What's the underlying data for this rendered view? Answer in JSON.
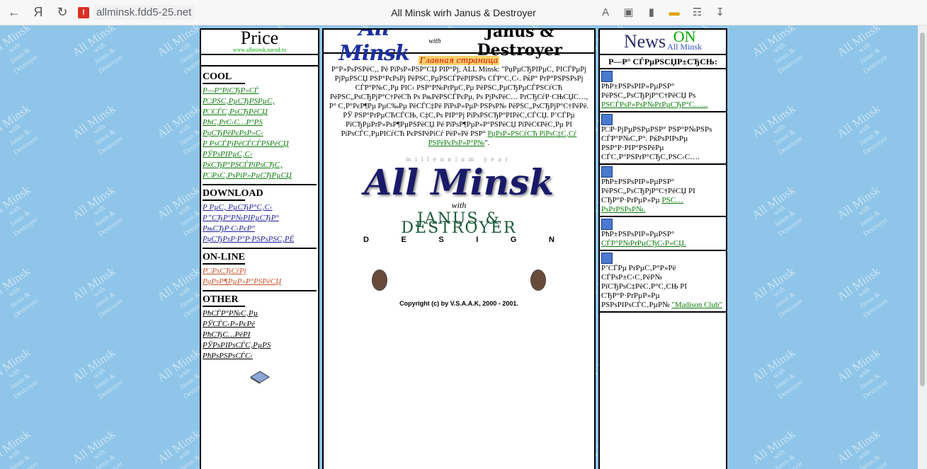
{
  "browser": {
    "url": "allminsk.fdd5-25.net",
    "title": "All Minsk wirh Janus & Destroyer",
    "back_glyph": "←",
    "home_glyph": "Я",
    "reload_glyph": "↻",
    "warning_glyph": "!"
  },
  "watermark": {
    "line1": "All Minsk",
    "line2": "with",
    "line3": "Janus &",
    "line4": "Destroyer"
  },
  "left": {
    "header": "Price",
    "header_sub": "www.allminsk.narod.ru",
    "sections": [
      {
        "title": "COOL",
        "style": "g",
        "items": [
          "Р—Р°РіСЂР»СЃ",
          "Р□РЅС‚РµСЂРЅРµС‚",
          "Р□СЃС‚РѕСЂРёСЏ",
          "РћС‚РґС‹С…Р°РЅ",
          "РџСЂРёРєРѕР»С‹",
          "Р РѕСЃРјРёСЃСЃРЅРёСЏ",
          "РЎРѕРІРµС‚С‹",
          "РќСЂР°РЅСЃРїРѕСЂС‚",
          "Р□РѕС‚РѕРіР»РµСЂРµСЏ"
        ]
      },
      {
        "title": "DOWNLOAD",
        "style": "b",
        "items": [
          "Р РµС‚ РµСЂР°С‚С‹",
          "Р”СЂР°Р№РІРµСЂР°",
          "РњСЂР·С‹РєР°",
          "РџСЂРѕР·Р°Р·РЅРѕРЅС‚РЁ"
        ]
      },
      {
        "title": "ON-LINE",
        "style": "o",
        "items": [
          "Р□РѕСЂСѓРј",
          "РџРѕР¶РµР»Р°РЅРёСЏ"
        ]
      },
      {
        "title": "OTHER",
        "style": "k",
        "items": [
          "РћСЃР°Р№С‚Рµ",
          "РЎСЃС‹Р»РєРё",
          "РћСЂС…РёРІ",
          "РЎРѕРІРѕСЃС‚РµРЅ",
          "РћРѕРЅРѕСЃС‹"
        ]
      }
    ]
  },
  "center": {
    "logo_all": "All Minsk",
    "logo_with": "with",
    "logo_jd": "Janus & Destroyer",
    "subtitle": "Главная страница",
    "text": "Р“Р»РѕРЅРёС‚, Рё РїРѕР»РЅР°СЏ РІР°Рј, ALL Minsk: \"РџРµСЂРІРµС‚ РІСЃРµРј РјРµРЅСЏ РЅР°РєРѕРј РёРЅС‚РµРЅСЃРёРІРЅРѕ СЃР°С‚С‹. РќР° РґР°РЅРЅРѕРј СЃР°Р№С‚Рµ РІС‹ РЅР°Р№РґРµС‚Рµ РёРЅС‚РµСЂРµСЃРЅСѓСЋ РёРЅС„РѕСЂРјР°С†РёСЋ Рѕ РњРёРЅСЃРєРµ, Рѕ РјРѕРёС… РґСЂСѓР·СЊСЏС…, Р° С‚Р°РєР¶Рµ РµС‰Рµ РёСЃС‡Рё РїРѕР»РµР·РЅРѕР№ РёРЅС„РѕСЂРјР°С†РёРё. РЎ РЅР°РґРµСЋСЃСЊ, С‡С‚Рѕ РІР°Рј РїРѕРЅСЂР°РІРёС‚СЃСЏ. Р’СЃРµ РїСЂРµРґР»РѕР¶РµРЅРёСЏ Рё РїРѕР¶РµР»Р°РЅРёСЏ РїРёС€РёС‚Рµ РІ РіРѕСЃС‚РµРІСѓСЋ РєРЅРёРіСѓ РёР»Рё РЅР° ",
    "link1": "РџРѕР»РЅСѓСЋ РїРѕС‡С‚Сѓ",
    "link2": "РЅРёРєРѕР»Р°Р№",
    "graphic_millennium": "millennium year",
    "graphic_title": "All Minsk",
    "graphic_with": "with",
    "graphic_jd": "JANUS & DESTROYER",
    "graphic_design": [
      "D",
      "E",
      "S",
      "I",
      "G",
      "N"
    ],
    "copyright": "Copyright (c) by V.S.A.A.K, 2000 - 2001."
  },
  "right": {
    "header_news": "News",
    "header_on": "ON",
    "header_minsk": "All Minsk",
    "subheader": "Р—Р° СЃРµРЅСЏР±СЂСЊ:",
    "items": [
      {
        "text": "РћР±РЅРѕРІР»РµРЅР° РёРЅС„РѕСЂРјР°С†РёСЏ Рѕ ",
        "link": "РЅСЃРѕР»РѕР№РґРµСЂР°С…..."
      },
      {
        "text": "Р□Р·РјРµРЅРµРЅР° РЅР°Р№РЅРѕ СЃР°Р№С‚Р°. РќРѕРІРѕРµ РЅР°Р·РІР°РЅРёРµ СЃС‚Р°РЅРґР°СЂС‚РЅС‹С….",
        "link": ""
      },
      {
        "text": "РћР±РЅРѕРІР»РµРЅР° РёРЅС„РѕСЂРјР°С†РёСЏ РІ СЂР°Р·РґРµР»Рµ ",
        "link": "РЅС…РѕРґРЅРѕР№."
      },
      {
        "text": "РћР±РЅРѕРІР»РµРЅР° ",
        "link": "СЃР°Р№РґРµСЂС‹Р»СЏ."
      },
      {
        "text": "Р’СЃРµ РґРµС‚Р°Р»Рё СЃРѕР±С‹С‚РёР№ РїСЂРѕС‡РёС‚Р°С‚СЊ РІ СЂР°Р·РґРµР»Рµ РЅРѕРІРѕСЃС‚РµР№ ",
        "link": "\"Madison Club\""
      }
    ]
  }
}
